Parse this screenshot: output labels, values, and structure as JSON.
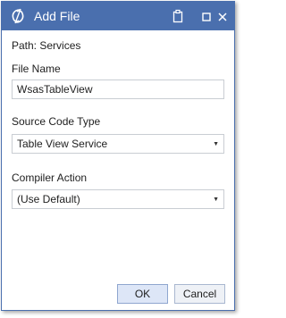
{
  "window": {
    "title": "Add File",
    "titlebar_color": "#4a6fae",
    "icons": [
      "app-logo-icon",
      "clipboard-icon",
      "maximize-icon",
      "close-icon"
    ]
  },
  "form": {
    "path_text": "Path:  Services",
    "file_name_label": "File Name",
    "file_name_value": "WsasTableView",
    "source_code_type_label": "Source Code Type",
    "source_code_type_value": "Table View Service",
    "compiler_action_label": "Compiler Action",
    "compiler_action_value": "(Use Default)"
  },
  "buttons": {
    "ok_label": "OK",
    "cancel_label": "Cancel"
  }
}
